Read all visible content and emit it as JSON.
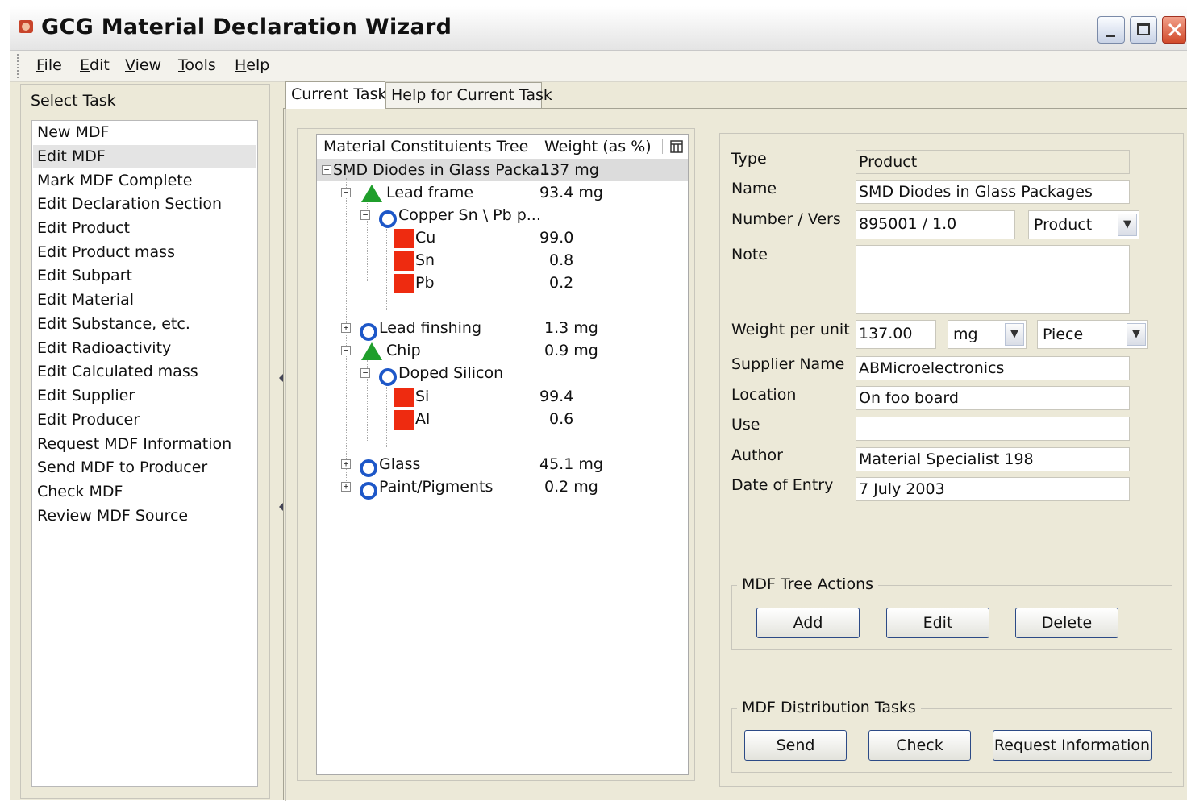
{
  "window": {
    "title": "GCG Material Declaration Wizard"
  },
  "menu": {
    "items": [
      "File",
      "Edit",
      "View",
      "Tools",
      "Help"
    ]
  },
  "left_panel": {
    "label": "Select Task",
    "tasks": [
      "New MDF",
      "Edit MDF",
      "Mark MDF Complete",
      "Edit Declaration Section",
      "Edit Product",
      "Edit Product mass",
      "Edit Subpart",
      "Edit Material",
      "Edit Substance, etc.",
      "Edit Radioactivity",
      "Edit Calculated mass",
      "Edit Supplier",
      "Edit Producer",
      "Request MDF Information",
      "Send MDF to Producer",
      "Check MDF",
      "Review MDF Source"
    ],
    "selected_index": 1
  },
  "tabs": {
    "current": "Current Task",
    "help": "Help for Current Task"
  },
  "tree": {
    "col1": "Material Constituients Tree",
    "col2": "Weight (as %)",
    "nodes": [
      {
        "label": "SMD Diodes in Glass Packa...",
        "weight": "137 mg"
      },
      {
        "label": "Lead frame",
        "weight": "93.4 mg"
      },
      {
        "label": "Copper Sn \\ Pb p...",
        "weight": ""
      },
      {
        "label": "Cu",
        "weight": "99.0"
      },
      {
        "label": "Sn",
        "weight": "0.8"
      },
      {
        "label": "Pb",
        "weight": "0.2"
      },
      {
        "label": "Lead finshing",
        "weight": "1.3 mg"
      },
      {
        "label": "Chip",
        "weight": "0.9 mg"
      },
      {
        "label": "Doped Silicon",
        "weight": ""
      },
      {
        "label": "Si",
        "weight": "99.4"
      },
      {
        "label": "Al",
        "weight": "0.6"
      },
      {
        "label": "Glass",
        "weight": "45.1 mg"
      },
      {
        "label": "Paint/Pigments",
        "weight": "0.2 mg"
      }
    ]
  },
  "form": {
    "type_label": "Type",
    "type_value": "Product",
    "name_label": "Name",
    "name_value": "SMD Diodes in Glass Packages",
    "number_label": "Number / Vers",
    "number_value": "895001 / 1.0",
    "number_combo": "Product",
    "note_label": "Note",
    "note_value": "",
    "weight_label": "Weight per unit",
    "weight_value": "137.00",
    "weight_unit": "mg",
    "weight_per": "Piece",
    "supplier_label": "Supplier Name",
    "supplier_value": "ABMicroelectronics",
    "location_label": "Location",
    "location_value": "On foo board",
    "use_label": "Use",
    "use_value": "",
    "author_label": "Author",
    "author_value": "Material Specialist 198",
    "date_label": "Date of Entry",
    "date_value": "7 July 2003"
  },
  "tree_actions": {
    "label": "MDF Tree Actions",
    "add": "Add",
    "edit": "Edit",
    "delete": "Delete"
  },
  "distribution": {
    "label": "MDF Distribution Tasks",
    "send": "Send",
    "check": "Check",
    "request": "Request Information"
  },
  "colors": {
    "substance_red": "#ee2b10",
    "subpart_green": "#1f9e2b",
    "material_blue": "#1d57c8"
  }
}
